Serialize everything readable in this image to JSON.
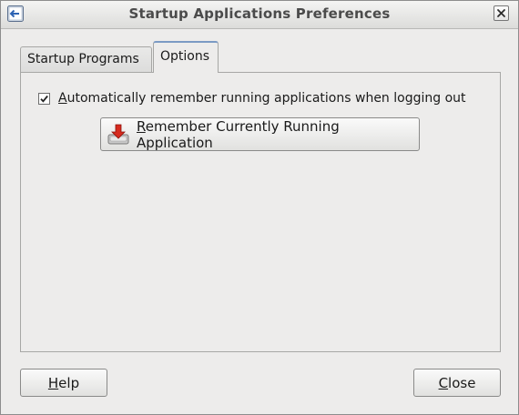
{
  "window": {
    "title": "Startup Applications Preferences"
  },
  "tabs": [
    {
      "label": "Startup Programs",
      "selected": false
    },
    {
      "label": "Options",
      "selected": true
    }
  ],
  "options": {
    "remember_checkbox": {
      "mnemonic": "A",
      "label_rest": "utomatically remember running applications when logging out",
      "checked": true
    },
    "remember_button": {
      "mnemonic": "R",
      "label_rest": "emember Currently Running Application",
      "icon": "save-session-icon"
    }
  },
  "footer": {
    "help": {
      "mnemonic": "H",
      "label_rest": "elp"
    },
    "close": {
      "mnemonic": "C",
      "label_rest": "lose"
    }
  },
  "colors": {
    "accent_tab": "#7b9ac4",
    "window_bg": "#edeceb"
  }
}
